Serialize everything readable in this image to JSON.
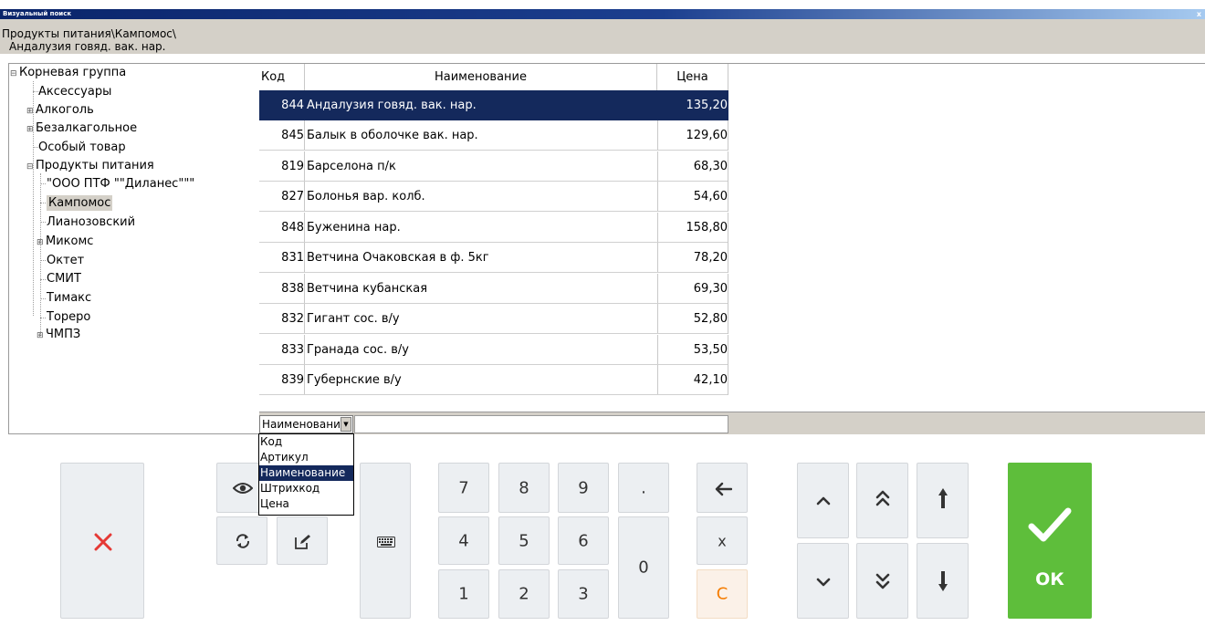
{
  "window": {
    "title": "Визуальный поиск",
    "close_glyph": "x"
  },
  "path": {
    "line1": "Продукты питания\\Кампомос\\",
    "line2": "Андалузия говяд. вак. нар."
  },
  "tree": {
    "items": [
      {
        "label": "Корневая группа",
        "toggle": "⊟"
      },
      {
        "label": "Аксессуары",
        "toggle": ""
      },
      {
        "label": "Алкоголь",
        "toggle": "⊞"
      },
      {
        "label": "Безалкагольное",
        "toggle": "⊞"
      },
      {
        "label": "Особый товар",
        "toggle": ""
      },
      {
        "label": "Продукты питания",
        "toggle": "⊟"
      },
      {
        "label": "\"ООО ПТФ \"\"Диланес\"\"\"",
        "toggle": ""
      },
      {
        "label": "Кампомос",
        "toggle": ""
      },
      {
        "label": "Лианозовский",
        "toggle": ""
      },
      {
        "label": "Микомс",
        "toggle": "⊞"
      },
      {
        "label": "Октет",
        "toggle": ""
      },
      {
        "label": "СМИТ",
        "toggle": ""
      },
      {
        "label": "Тимакс",
        "toggle": ""
      },
      {
        "label": "Тореро",
        "toggle": ""
      },
      {
        "label": "ЧМПЗ",
        "toggle": "⊞"
      }
    ]
  },
  "grid": {
    "headers": {
      "code": "Код",
      "name": "Наименование",
      "price": "Цена"
    },
    "rows": [
      {
        "code": "844",
        "name": "Андалузия говяд. вак. нар.",
        "price": "135,20"
      },
      {
        "code": "845",
        "name": "Балык в оболочке вак. нар.",
        "price": "129,60"
      },
      {
        "code": "819",
        "name": "Барселона п/к",
        "price": "68,30"
      },
      {
        "code": "827",
        "name": "Болонья вар. колб.",
        "price": "54,60"
      },
      {
        "code": "848",
        "name": "Буженина нар.",
        "price": "158,80"
      },
      {
        "code": "831",
        "name": "Ветчина Очаковская в ф. 5кг",
        "price": "78,20"
      },
      {
        "code": "838",
        "name": "Ветчина кубанская",
        "price": "69,30"
      },
      {
        "code": "832",
        "name": "Гигант сос. в/у",
        "price": "52,80"
      },
      {
        "code": "833",
        "name": "Гранада сос. в/у",
        "price": "53,50"
      },
      {
        "code": "839",
        "name": "Губернские в/у",
        "price": "42,10"
      }
    ]
  },
  "search": {
    "field_value": "Наименование",
    "input_value": "",
    "options": [
      "Код",
      "Артикул",
      "Наименование",
      "Штрихкод",
      "Цена"
    ]
  },
  "keypad": {
    "k7": "7",
    "k8": "8",
    "k9": "9",
    "dot": ".",
    "k4": "4",
    "k5": "5",
    "k6": "6",
    "k0": "0",
    "k1": "1",
    "k2": "2",
    "k3": "3",
    "x": "x",
    "c": "C"
  },
  "ok": {
    "label": "ОК"
  },
  "colors": {
    "accent_ok": "#5ebe3b",
    "selection": "#14295c",
    "cancel": "#e53935",
    "clear": "#f57c00"
  },
  "icons": [
    "close-icon",
    "eye-icon",
    "refresh-icon",
    "edit-icon",
    "keyboard-icon",
    "backspace-icon",
    "chevron-up-icon",
    "double-chevron-up-icon",
    "arrow-up-icon",
    "chevron-down-icon",
    "double-chevron-down-icon",
    "arrow-down-icon",
    "check-icon"
  ]
}
